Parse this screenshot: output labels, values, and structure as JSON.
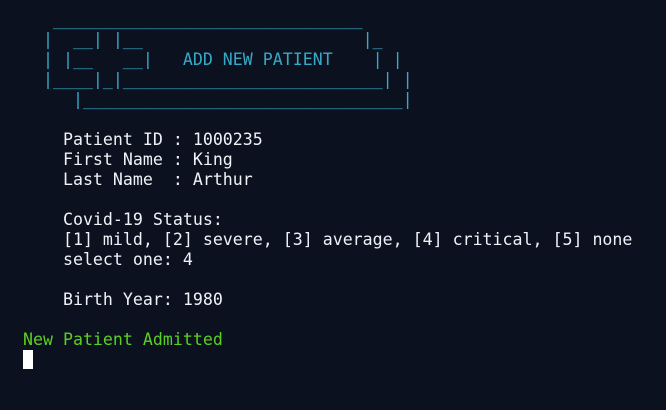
{
  "banner": {
    "title": "ADD NEW PATIENT",
    "lines": [
      "   _______________________________",
      "  |  __| |__                      |_",
      "  | |__   __|   ADD NEW PATIENT    | |",
      "  |____|_|__________________________| |",
      "     |________________________________|"
    ]
  },
  "form": {
    "patient_id_line": "    Patient ID : 1000235",
    "first_name_line": "    First Name : King",
    "last_name_line": "    Last Name  : Arthur",
    "covid_status_label": "    Covid-19 Status:",
    "covid_options_line": "    [1] mild, [2] severe, [3] average, [4] critical, [5] none",
    "select_line": "    select one: 4",
    "birth_year_line": "    Birth Year: 1980"
  },
  "status": {
    "message": "New Patient Admitted",
    "color": "#5ad021"
  },
  "colors": {
    "background": "#0c111f",
    "banner": "#35a9c7",
    "text": "#eef1f6"
  }
}
